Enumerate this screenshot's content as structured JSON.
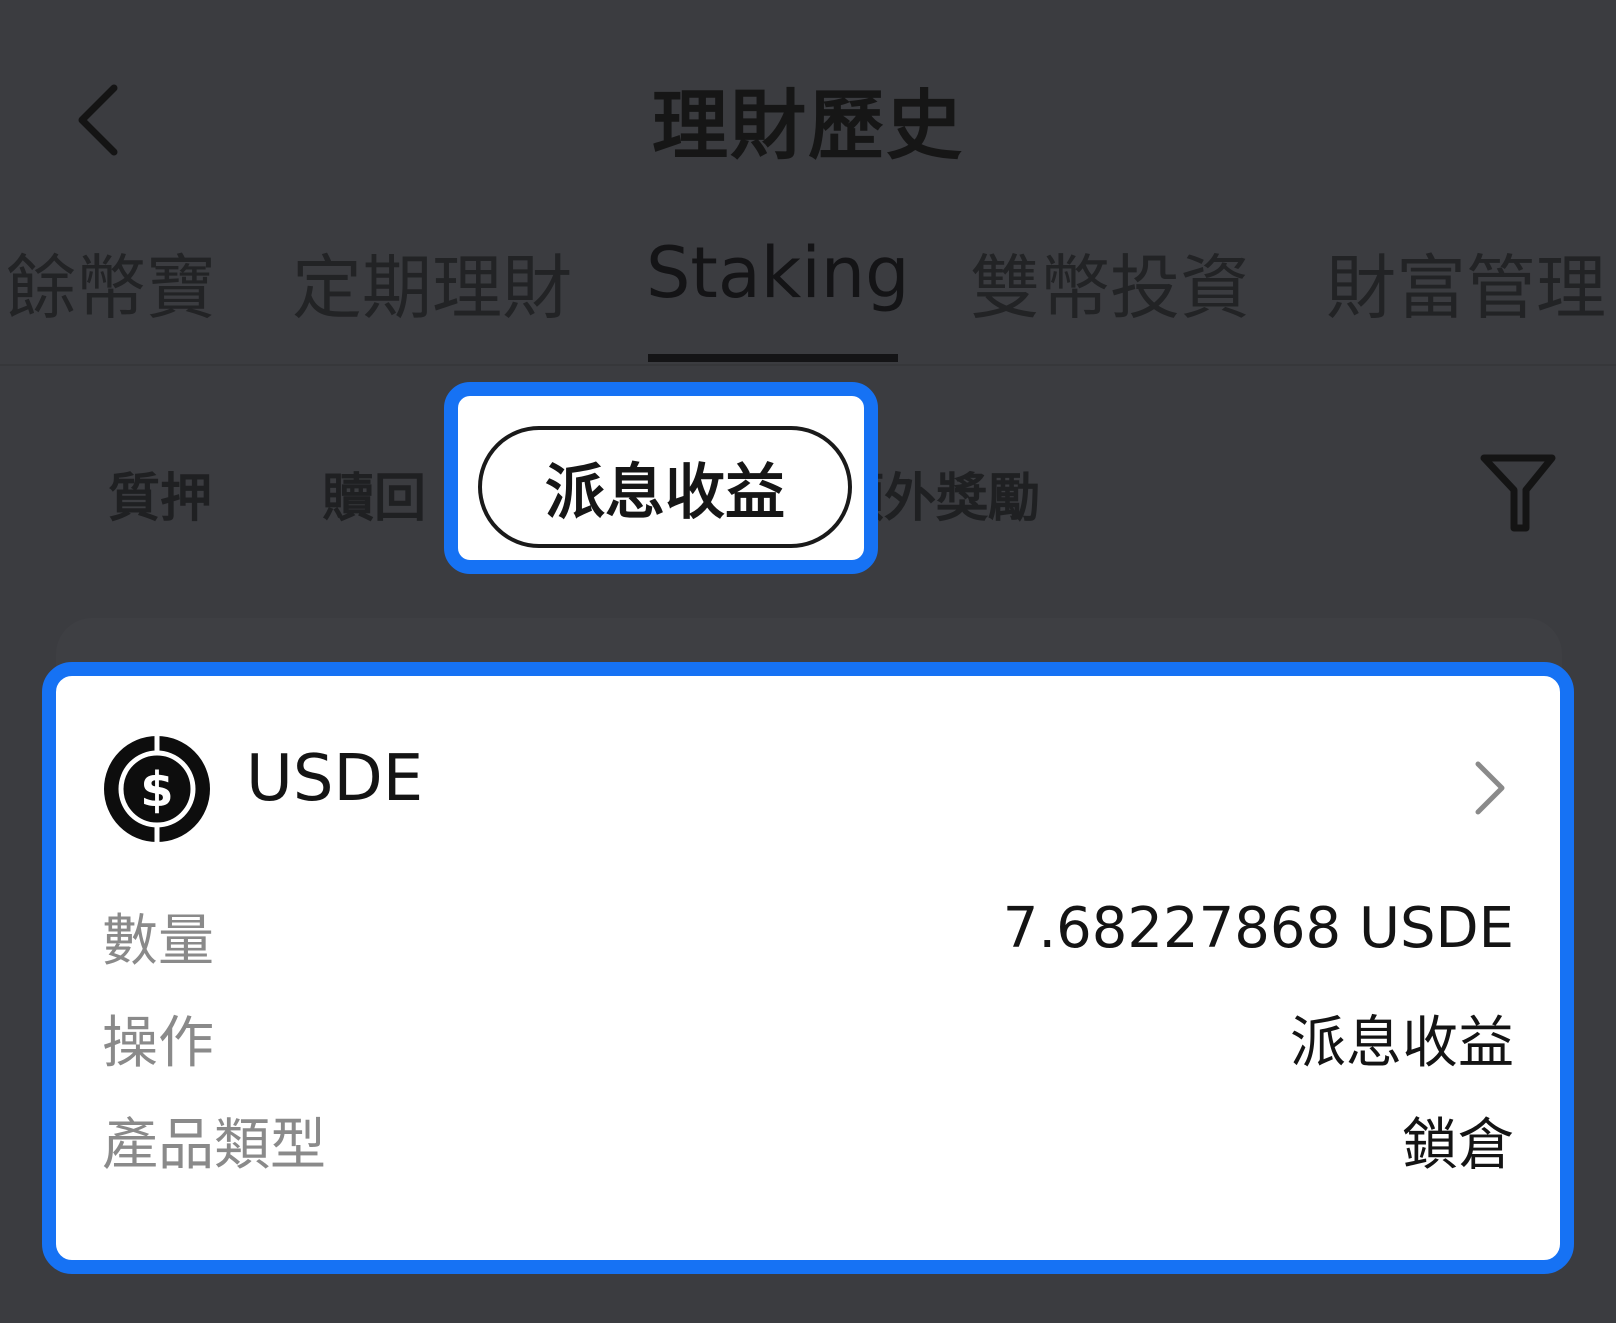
{
  "header": {
    "title": "理財歷史"
  },
  "tabs": [
    {
      "label": "餘幣寶"
    },
    {
      "label": "定期理財"
    },
    {
      "label": "Staking"
    },
    {
      "label": "雙幣投資"
    },
    {
      "label": "財富管理"
    }
  ],
  "subtabs": [
    {
      "label": "質押"
    },
    {
      "label": "贖回"
    },
    {
      "label": "派息收益"
    },
    {
      "label": "額外獎勵"
    }
  ],
  "record": {
    "coin": "USDE",
    "rows": [
      {
        "label": "數量",
        "value": "7.68227868 USDE"
      },
      {
        "label": "操作",
        "value": "派息收益"
      },
      {
        "label": "產品類型",
        "value": "鎖倉"
      }
    ]
  },
  "icons": {
    "back": "chevron-left-icon",
    "filter": "filter-icon",
    "coin": "dollar-coin-icon",
    "detail": "chevron-right-icon"
  },
  "colors": {
    "highlight": "#1672f4",
    "overlay_background": "#3b3c40",
    "card": "#ffffff"
  }
}
